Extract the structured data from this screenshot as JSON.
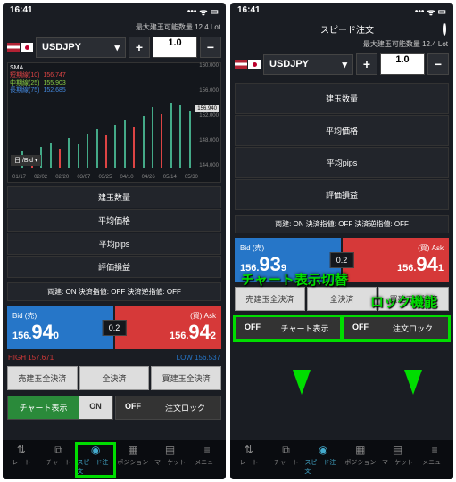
{
  "status": {
    "time": "16:41"
  },
  "left": {
    "maxLot": "最大建玉可能数量 12.4 Lot",
    "pair": "USDJPY",
    "qty": "1.0",
    "sma": {
      "title": "SMA",
      "lines": [
        {
          "label": "短期線(10)",
          "value": "156.747",
          "color": "#d44"
        },
        {
          "label": "中期線(25)",
          "value": "155.903",
          "color": "#8c4"
        },
        {
          "label": "長期線(75)",
          "value": "152.685",
          "color": "#48d"
        }
      ]
    },
    "priceLabel": "156.940",
    "chartMode": "日 /Bid",
    "yTicks": [
      "160.000",
      "156.000",
      "152.000",
      "148.000",
      "144.000"
    ],
    "xTicks": [
      "01/17",
      "02/02",
      "02/20",
      "03/07",
      "03/25",
      "04/10",
      "04/26",
      "05/14",
      "05/30"
    ],
    "rows": [
      "建玉数量",
      "平均価格",
      "平均pips",
      "評価損益"
    ],
    "settle": "両建: ON  決済指値: OFF 決済逆指値: OFF",
    "bid": {
      "label": "Bid (売)",
      "pre": "156.",
      "big": "94",
      "post": "0"
    },
    "ask": {
      "label": "(買) Ask",
      "pre": "156.",
      "big": "94",
      "post": "2"
    },
    "spread": "0.2",
    "high": "HIGH 157.671",
    "low": "LOW 156.537",
    "settleBtns": [
      "売建玉全決済",
      "全決済",
      "買建玉全決済"
    ],
    "toggles": [
      {
        "label": "チャート表示",
        "state": "ON",
        "active": true
      },
      {
        "label": "注文ロック",
        "state": "OFF",
        "active": false
      }
    ]
  },
  "right": {
    "title": "スピード注文",
    "maxLot": "最大建玉可能数量 12.4 Lot",
    "pair": "USDJPY",
    "qty": "1.0",
    "rows": [
      "建玉数量",
      "平均価格",
      "平均pips",
      "評価損益"
    ],
    "settle": "両建: ON  決済指値: OFF 決済逆指値: OFF",
    "bid": {
      "label": "Bid (売)",
      "pre": "156.",
      "big": "93",
      "post": "9"
    },
    "ask": {
      "label": "(買) Ask",
      "pre": "156.",
      "big": "94",
      "post": "1"
    },
    "spread": "0.2",
    "settleBtns": [
      "売建玉全決済",
      "全決済",
      "買建玉全決済"
    ],
    "toggles": [
      {
        "label": "チャート表示",
        "state": "OFF",
        "active": false
      },
      {
        "label": "注文ロック",
        "state": "OFF",
        "active": false
      }
    ],
    "annotations": [
      "チャート表示切替",
      "ロック機能"
    ]
  },
  "tabs": [
    "レート",
    "チャート",
    "スピード注文",
    "ポジション",
    "マーケット",
    "メニュー"
  ],
  "tabIcons": [
    "⇅",
    "⧉",
    "◉",
    "▦",
    "▤",
    "≡"
  ]
}
